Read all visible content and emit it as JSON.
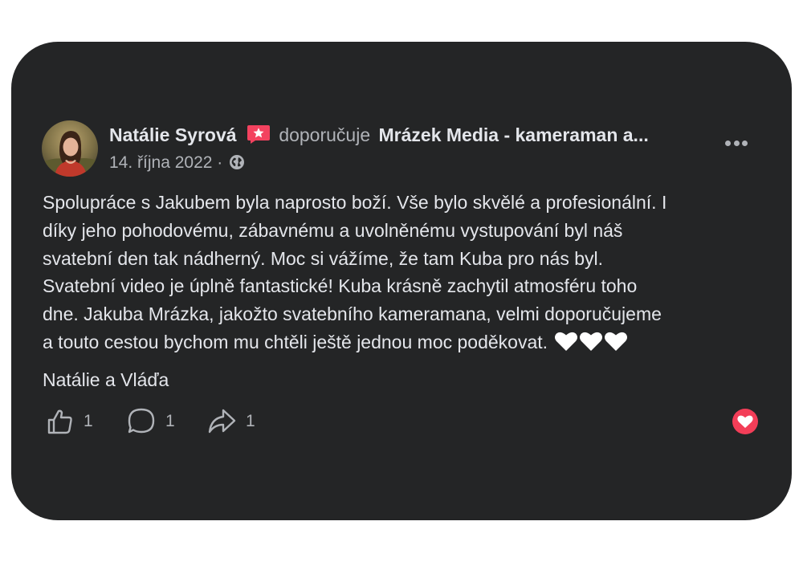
{
  "post": {
    "author_name": "Natálie Syrová",
    "action_text": "doporučuje",
    "page_name": "Mrázek Media - kameraman a...",
    "date": "14. října 2022",
    "separator": "·",
    "audience_icon": "globe-icon",
    "recommendation_icon": "recommendation-star-icon",
    "body_lines": [
      "Spolupráce s Jakubem byla naprosto boží. Vše bylo skvělé a profesionální. I",
      "díky jeho pohodovému, zábavnému a uvolněnému vystupování byl náš",
      "svatební den tak nádherný. Moc si vážíme, že tam Kuba pro nás byl.",
      "Svatební video je úplně fantastické!  Kuba krásně zachytil atmosféru toho",
      "dne. Jakuba Mrázka, jakožto svatebního kameramana, velmi doporučujeme",
      "a touto cestou bychom mu chtěli ještě jednou moc poděkovat."
    ],
    "signature": "Natálie a Vláďa",
    "likes_count": "1",
    "comments_count": "1",
    "shares_count": "1",
    "reaction_icon": "love-reaction-icon"
  },
  "colors": {
    "card_background": "#242526",
    "primary_text": "#e4e6eb",
    "secondary_text": "#b0b3b8",
    "recommend_badge": "#f3425f",
    "love_reaction": "#f33e58"
  }
}
